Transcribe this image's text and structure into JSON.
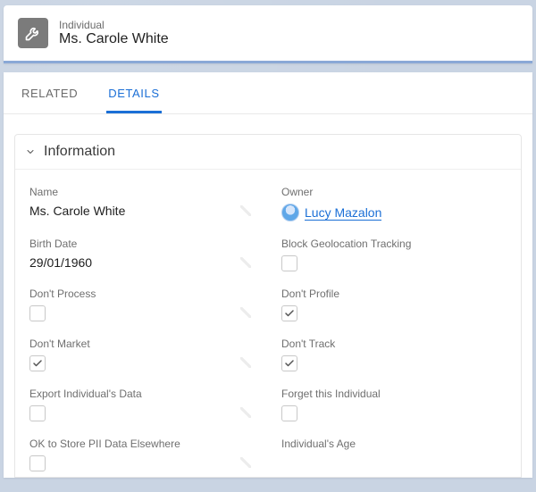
{
  "header": {
    "object_type": "Individual",
    "title": "Ms. Carole White"
  },
  "tabs": {
    "related": "RELATED",
    "details": "DETAILS"
  },
  "section": {
    "information_title": "Information"
  },
  "fields": {
    "name": {
      "label": "Name",
      "value": "Ms. Carole White"
    },
    "owner": {
      "label": "Owner",
      "value": "Lucy Mazalon"
    },
    "birth_date": {
      "label": "Birth Date",
      "value": "29/01/1960"
    },
    "block_geo": {
      "label": "Block Geolocation Tracking",
      "checked": false
    },
    "dont_process": {
      "label": "Don't Process",
      "checked": false
    },
    "dont_profile": {
      "label": "Don't Profile",
      "checked": true
    },
    "dont_market": {
      "label": "Don't Market",
      "checked": true
    },
    "dont_track": {
      "label": "Don't Track",
      "checked": true
    },
    "export_data": {
      "label": "Export Individual's Data",
      "checked": false
    },
    "forget": {
      "label": "Forget this Individual",
      "checked": false
    },
    "ok_store_pii": {
      "label": "OK to Store PII Data Elsewhere",
      "checked": false
    },
    "individuals_age": {
      "label": "Individual's Age",
      "value": ""
    }
  }
}
